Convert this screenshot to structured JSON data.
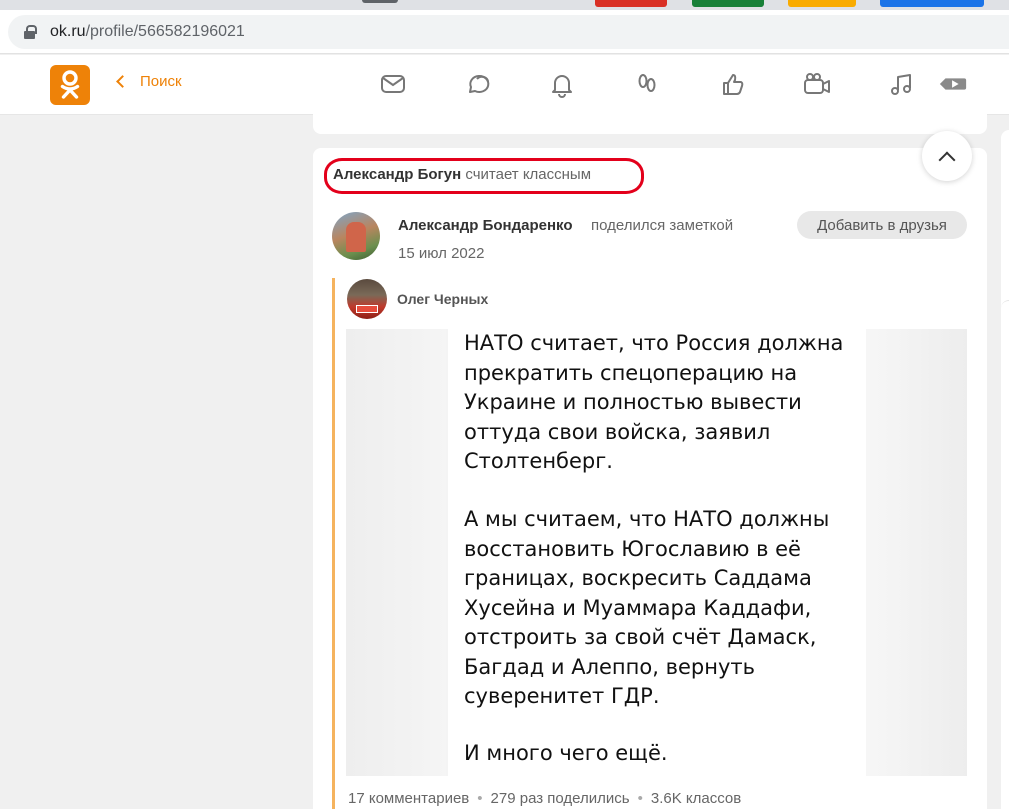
{
  "browser": {
    "url_host": "ok.ru",
    "url_path": "/profile/566582196021"
  },
  "header": {
    "back_label": "Поиск",
    "nav_icons": [
      "messages-icon",
      "discussions-icon",
      "notifications-icon",
      "guests-icon",
      "marks-icon",
      "video-icon",
      "music-icon",
      "video-player-icon"
    ],
    "accent_color": "#ee8208"
  },
  "feed": {
    "liked_by": {
      "name": "Александр Богун",
      "action": "считает классным"
    },
    "post": {
      "author": "Александр Бондаренко",
      "action": "поделился заметкой",
      "date": "15 июл 2022",
      "add_friend_label": "Добавить в друзья",
      "original_author": "Олег Черных",
      "image_text_1": "НАТО считает, что Россия должна\nпрекратить спецоперацию на\nУкраине и полностью вывести\nоттуда свои войска, заявил\nСтолтенберг.",
      "image_text_2": "А мы считаем, что НАТО должны\nвосстановить Югославию в её\nграницах, воскресить Саддама\nХусейна и Муаммара Каддафи,\nотстроить за свой счёт Дамаск,\nБагдад и Алеппо, вернуть\nсуверенитет ГДР.",
      "image_text_3": "И много чего ещё.",
      "stats": {
        "comments": "17 комментариев",
        "shares": "279 раз поделились",
        "likes": "3.6K классов"
      }
    }
  }
}
